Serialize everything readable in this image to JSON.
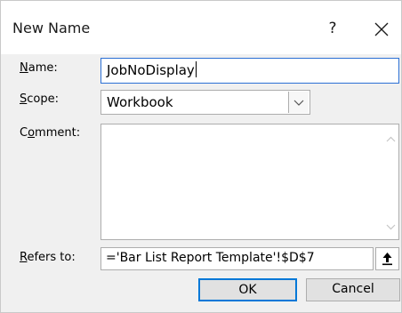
{
  "dialog": {
    "title": "New Name",
    "help_glyph": "?",
    "close_icon": "close-icon"
  },
  "form": {
    "name_label_accel": "N",
    "name_label_rest": "ame:",
    "name_value": "JobNoDisplay",
    "scope_label_accel": "S",
    "scope_label_rest": "cope:",
    "scope_value": "Workbook",
    "comment_label_pre": "C",
    "comment_label_accel": "o",
    "comment_label_rest": "mment:",
    "comment_value": "",
    "refers_label_accel": "R",
    "refers_label_rest": "efers to:",
    "refers_value": "='Bar List Report Template'!$D$7"
  },
  "buttons": {
    "ok_label": "OK",
    "cancel_label": "Cancel"
  },
  "colors": {
    "focus_border": "#2b6fd4",
    "default_button_border": "#0078d7"
  }
}
